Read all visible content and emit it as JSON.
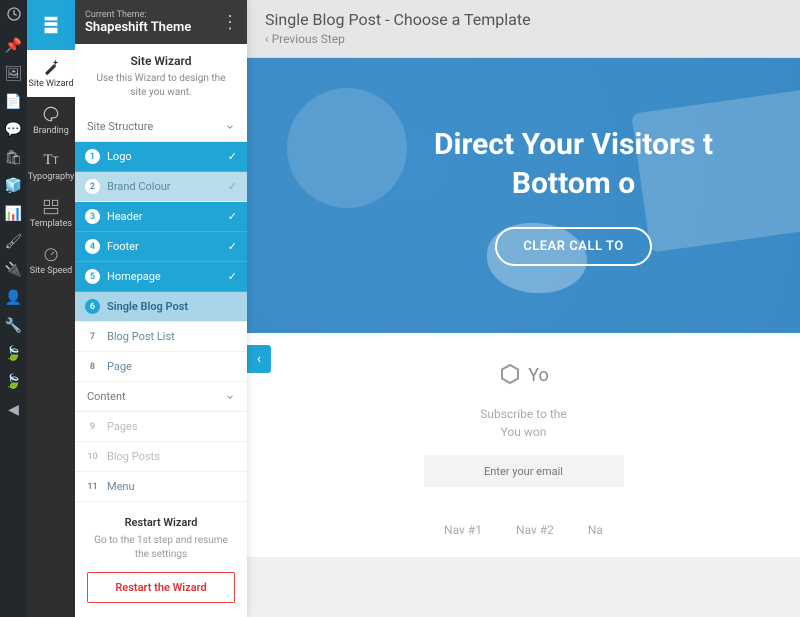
{
  "theme": {
    "current_label": "Current Theme:",
    "name": "Shapeshift Theme"
  },
  "toolRail": {
    "items": [
      {
        "label": "Site Wizard",
        "name": "site-wizard"
      },
      {
        "label": "Branding",
        "name": "branding"
      },
      {
        "label": "Typography",
        "name": "typography"
      },
      {
        "label": "Templates",
        "name": "templates"
      },
      {
        "label": "Site Speed",
        "name": "site-speed"
      }
    ]
  },
  "wizard": {
    "title": "Site Wizard",
    "description": "Use this Wizard to design the site you want.",
    "sections": {
      "structure": {
        "title": "Site Structure"
      },
      "content": {
        "title": "Content"
      }
    },
    "structureSteps": [
      {
        "n": "1",
        "label": "Logo",
        "state": "done"
      },
      {
        "n": "2",
        "label": "Brand Colour",
        "state": "done-light"
      },
      {
        "n": "3",
        "label": "Header",
        "state": "done"
      },
      {
        "n": "4",
        "label": "Footer",
        "state": "done"
      },
      {
        "n": "5",
        "label": "Homepage",
        "state": "done"
      },
      {
        "n": "6",
        "label": "Single Blog Post",
        "state": "active"
      },
      {
        "n": "7",
        "label": "Blog Post List",
        "state": "pending"
      },
      {
        "n": "8",
        "label": "Page",
        "state": "pending"
      }
    ],
    "contentSteps": [
      {
        "n": "9",
        "label": "Pages",
        "state": "muted"
      },
      {
        "n": "10",
        "label": "Blog Posts",
        "state": "muted"
      },
      {
        "n": "11",
        "label": "Menu",
        "state": "pending"
      }
    ],
    "restart": {
      "title": "Restart Wizard",
      "desc": "Go to the 1st step and resume the settings",
      "button": "Restart the Wizard"
    }
  },
  "main": {
    "title": "Single Blog Post - Choose a Template",
    "prev": "Previous Step",
    "hero": {
      "line1": "Direct Your Visitors t",
      "line2": "Bottom o",
      "cta": "CLEAR CALL TO"
    },
    "brand": "Yo",
    "subscribe": {
      "line1": "Subscribe to the",
      "line2": "You won",
      "placeholder": "Enter your email"
    },
    "nav": [
      "Nav #1",
      "Nav #2",
      "Na"
    ]
  }
}
